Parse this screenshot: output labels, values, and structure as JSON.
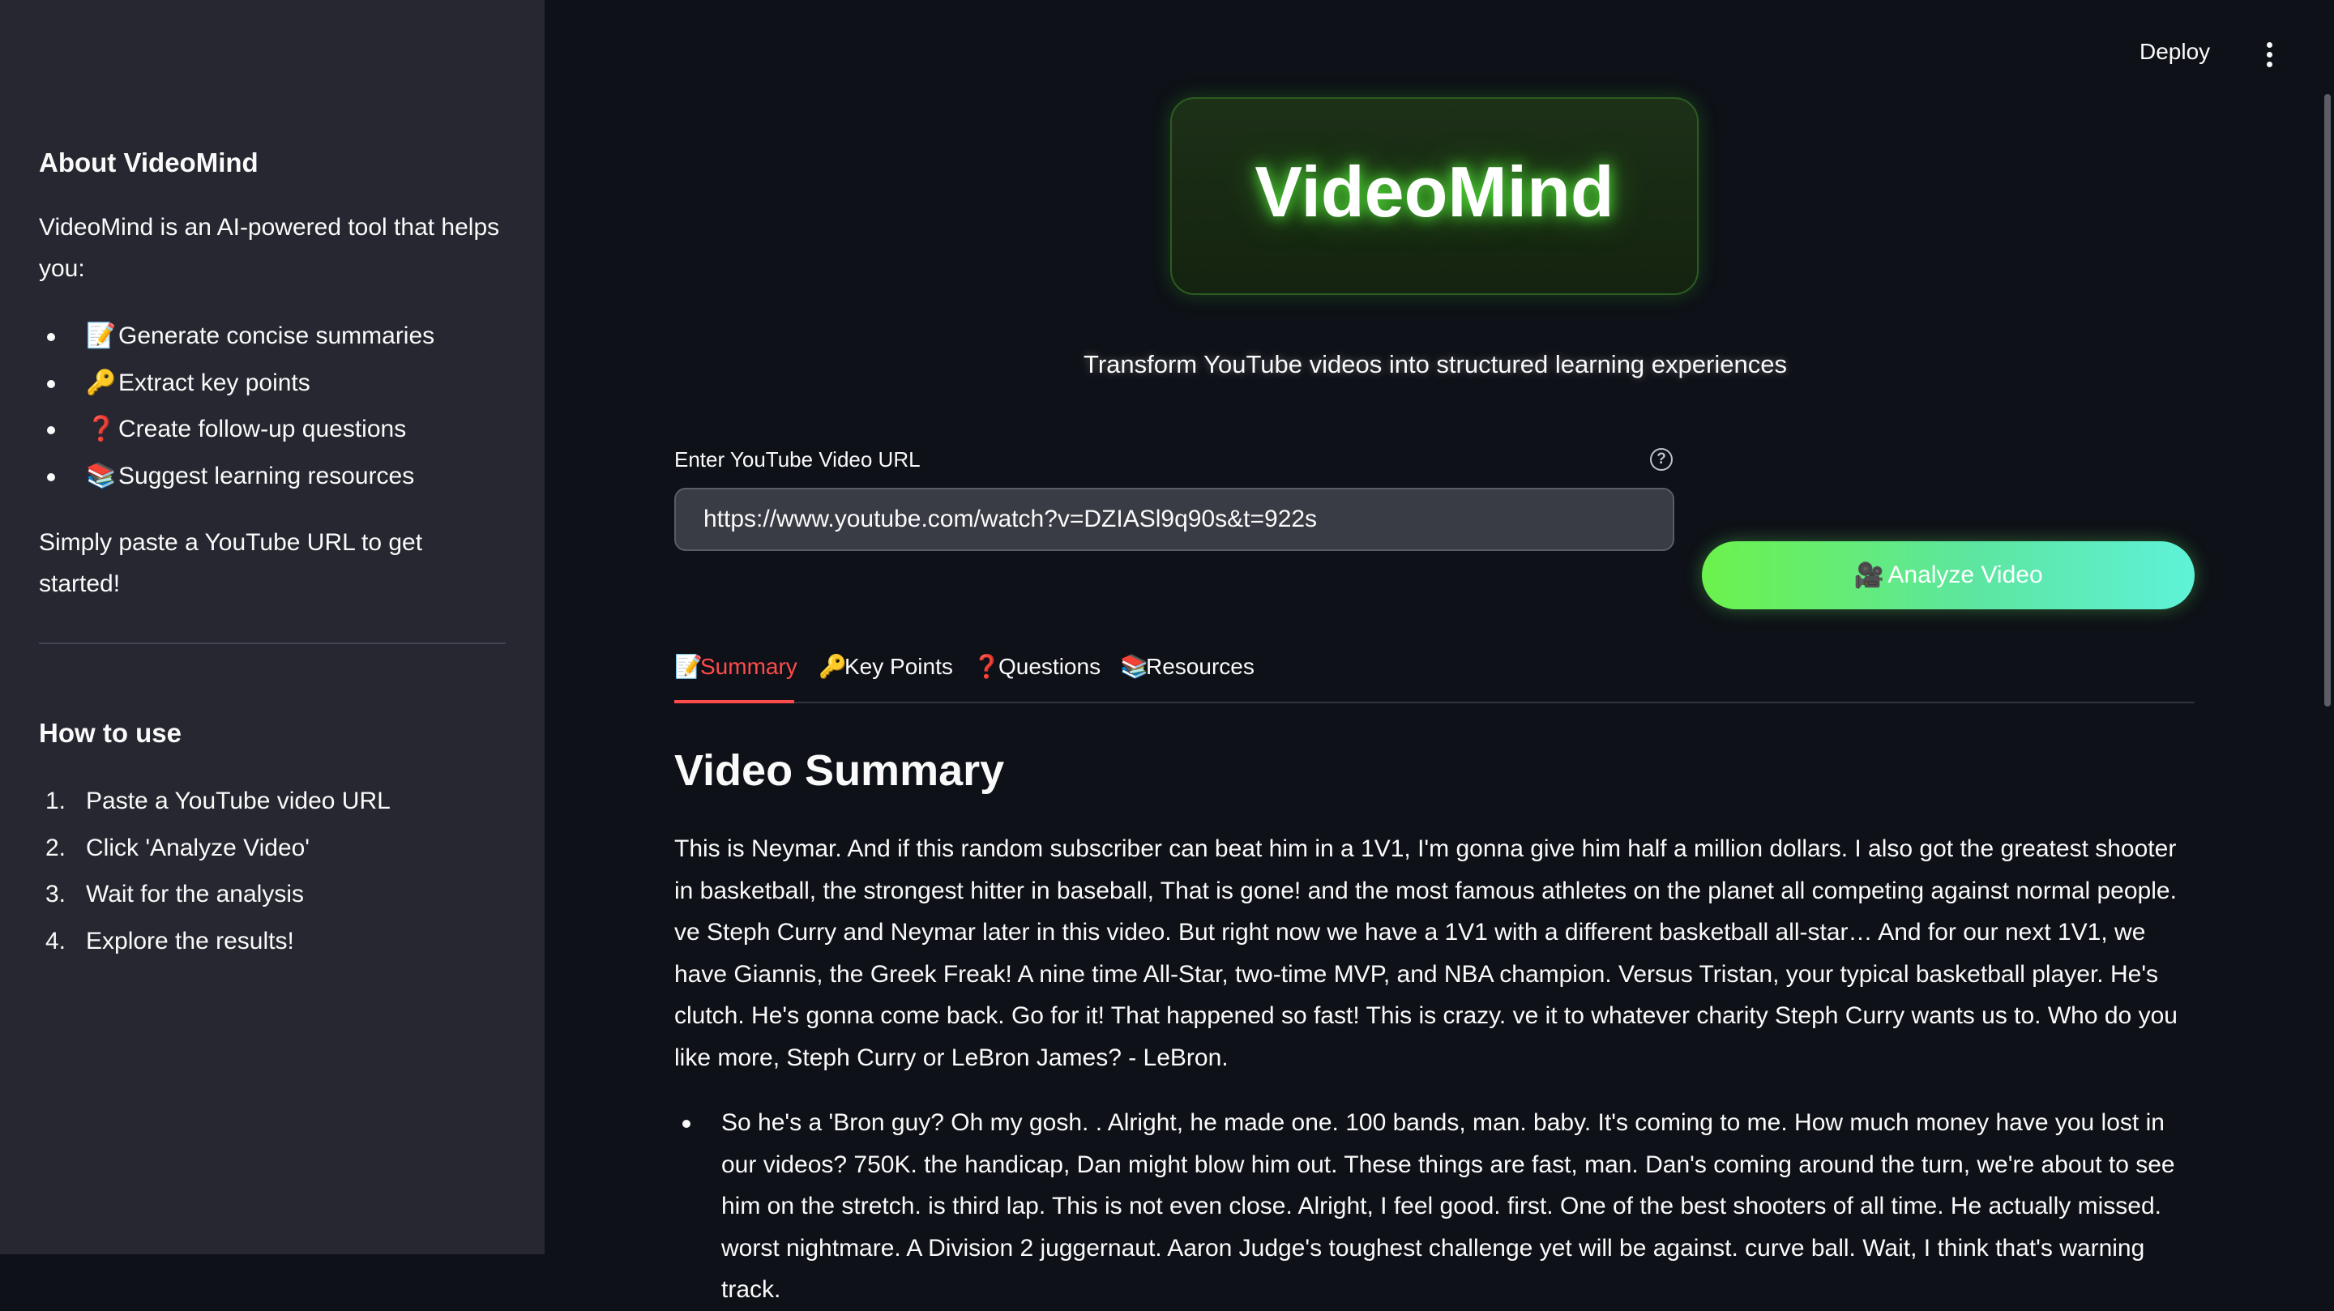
{
  "sidebar": {
    "about_heading": "About VideoMind",
    "about_text": "VideoMind is an AI-powered tool that helps you:",
    "features": [
      {
        "icon": "📝",
        "label": "Generate concise summaries"
      },
      {
        "icon": "🔑",
        "label": "Extract key points"
      },
      {
        "icon": "❓",
        "label": "Create follow-up questions"
      },
      {
        "icon": "📚",
        "label": "Suggest learning resources"
      }
    ],
    "cta_text": "Simply paste a YouTube URL to get started!",
    "howto_heading": "How to use",
    "steps": [
      {
        "num": "1.",
        "label": "Paste a YouTube video URL"
      },
      {
        "num": "2.",
        "label": "Click 'Analyze Video'"
      },
      {
        "num": "3.",
        "label": "Wait for the analysis"
      },
      {
        "num": "4.",
        "label": "Explore the results!"
      }
    ]
  },
  "header": {
    "deploy_label": "Deploy",
    "menu_icon": "kebab-menu-icon"
  },
  "hero": {
    "logo_text": "VideoMind",
    "tagline": "Transform YouTube videos into structured learning experiences"
  },
  "url_input": {
    "label": "Enter YouTube Video URL",
    "help_icon": "?",
    "value": "https://www.youtube.com/watch?v=DZIASl9q90s&t=922s"
  },
  "analyze_button": {
    "icon": "🎥",
    "label": "Analyze Video"
  },
  "tabs": [
    {
      "icon": "📝",
      "label": "Summary",
      "active": true
    },
    {
      "icon": "🔑",
      "label": "Key Points",
      "active": false
    },
    {
      "icon": "❓",
      "label": "Questions",
      "active": false
    },
    {
      "icon": "📚",
      "label": "Resources",
      "active": false
    }
  ],
  "summary": {
    "title": "Video Summary",
    "paragraph": "This is Neymar. And if this random subscriber can beat him in a 1V1, I'm gonna give him half a million dollars. I also got the greatest shooter in basketball, the strongest hitter in baseball, That is gone! and the most famous athletes on the planet all competing against normal people. ve Steph Curry and Neymar later in this video. But right now we have a 1V1 with a different basketball all-star… And for our next 1V1, we have Giannis, the Greek Freak! A nine time All-Star, two-time MVP, and NBA champion. Versus Tristan, your typical basketball player. He's clutch. He's gonna come back. Go for it! That happened so fast! This is crazy. ve it to whatever charity Steph Curry wants us to. Who do you like more, Steph Curry or LeBron James? - LeBron.",
    "bullet": "So he's a 'Bron guy? Oh my gosh. . Alright, he made one. 100 bands, man. baby. It's coming to me. How much money have you lost in our videos? 750K. the handicap, Dan might blow him out. These things are fast, man. Dan's coming around the turn, we're about to see him on the stretch. is third lap. This is not even close. Alright, I feel good. first. One of the best shooters of all time. He actually missed. worst nightmare. A Division 2 juggernaut. Aaron Judge's toughest challenge yet will be against. curve ball. Wait, I think that's warning track."
  },
  "colors": {
    "background": "#0e1117",
    "sidebar": "#262730",
    "accent_red": "#ff4b4b",
    "button_gradient_start": "#6cf24c",
    "button_gradient_end": "#5ef2d8",
    "logo_glow": "#5aff3c"
  }
}
